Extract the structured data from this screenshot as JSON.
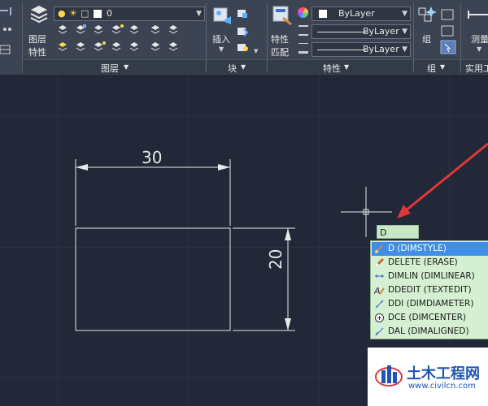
{
  "ribbon": {
    "layer_props_label": [
      "图层",
      "特性"
    ],
    "layer_dropdown_value": "0",
    "layers_panel_title": "图层",
    "insert_label": "插入",
    "block_panel_title": "块",
    "match_props_label": [
      "特性",
      "匹配"
    ],
    "color_value": "ByLayer",
    "linetype_value": "ByLayer",
    "lineweight_value": "ByLayer",
    "properties_panel_title": "特性",
    "group_label": "组",
    "group_panel_title": "组",
    "measure_label": "测量",
    "utilities_panel_title": "实用工"
  },
  "drawing": {
    "width_dimension": "30",
    "height_dimension": "20"
  },
  "command_line": {
    "typed_text": "D"
  },
  "suggestions": [
    {
      "label": "D (DIMSTYLE)",
      "icon": "dimstyle-icon",
      "selected": true
    },
    {
      "label": "DELETE (ERASE)",
      "icon": "eraser-icon",
      "selected": false
    },
    {
      "label": "DIMLIN (DIMLINEAR)",
      "icon": "linear-dimension-icon",
      "selected": false
    },
    {
      "label": "DDEDIT (TEXTEDIT)",
      "icon": "text-edit-icon",
      "selected": false
    },
    {
      "label": "DDI (DIMDIAMETER)",
      "icon": "diameter-dimension-icon",
      "selected": false
    },
    {
      "label": "DCE (DIMCENTER)",
      "icon": "center-mark-icon",
      "selected": false
    },
    {
      "label": "DAL (DIMALIGNED)",
      "icon": "aligned-dimension-icon",
      "selected": false
    }
  ],
  "watermark": {
    "title": "土木工程网",
    "url": "www.civilcn.com"
  },
  "colors": {
    "canvas_bg": "#222838",
    "ribbon_bg": "#3c4352",
    "arrow": "#e0383a",
    "suggest_bg": "#d4efd1",
    "selected_bg": "#3f8ee8"
  }
}
